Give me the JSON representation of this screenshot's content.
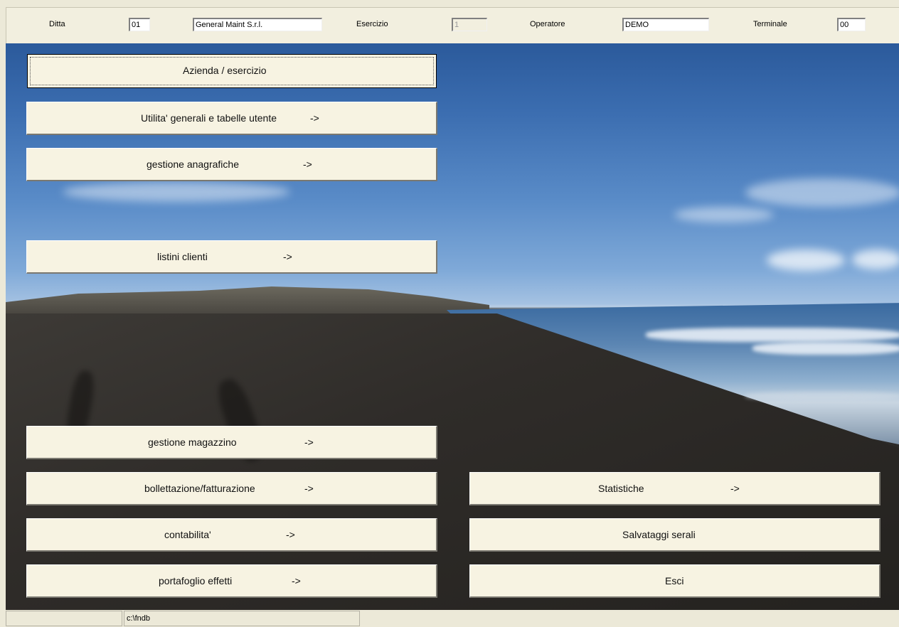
{
  "header": {
    "ditta_label": "Ditta",
    "ditta_code": "01",
    "ditta_name": "General Maint S.r.l.",
    "esercizio_label": "Esercizio",
    "esercizio_value": "1",
    "operatore_label": "Operatore",
    "operatore_value": "DEMO",
    "terminale_label": "Terminale",
    "terminale_value": "00"
  },
  "menu": {
    "azienda": {
      "label": "Azienda / esercizio"
    },
    "utilita": {
      "label": "Utilita' generali e tabelle utente",
      "arrow": "->"
    },
    "anagrafiche": {
      "label": "gestione anagrafiche",
      "arrow": "->"
    },
    "listini": {
      "label": "listini clienti",
      "arrow": "->"
    },
    "magazzino": {
      "label": "gestione magazzino",
      "arrow": "->"
    },
    "bollettazione": {
      "label": "bollettazione/fatturazione",
      "arrow": "->"
    },
    "contabilita": {
      "label": "contabilita'",
      "arrow": "->"
    },
    "portafoglio": {
      "label": "portafoglio effetti",
      "arrow": "->"
    },
    "statistiche": {
      "label": "Statistiche",
      "arrow": "->"
    },
    "salvataggi": {
      "label": "Salvataggi serali"
    },
    "esci": {
      "label": "Esci"
    }
  },
  "statusbar": {
    "panel1": "",
    "path": "c:\\fndb"
  }
}
